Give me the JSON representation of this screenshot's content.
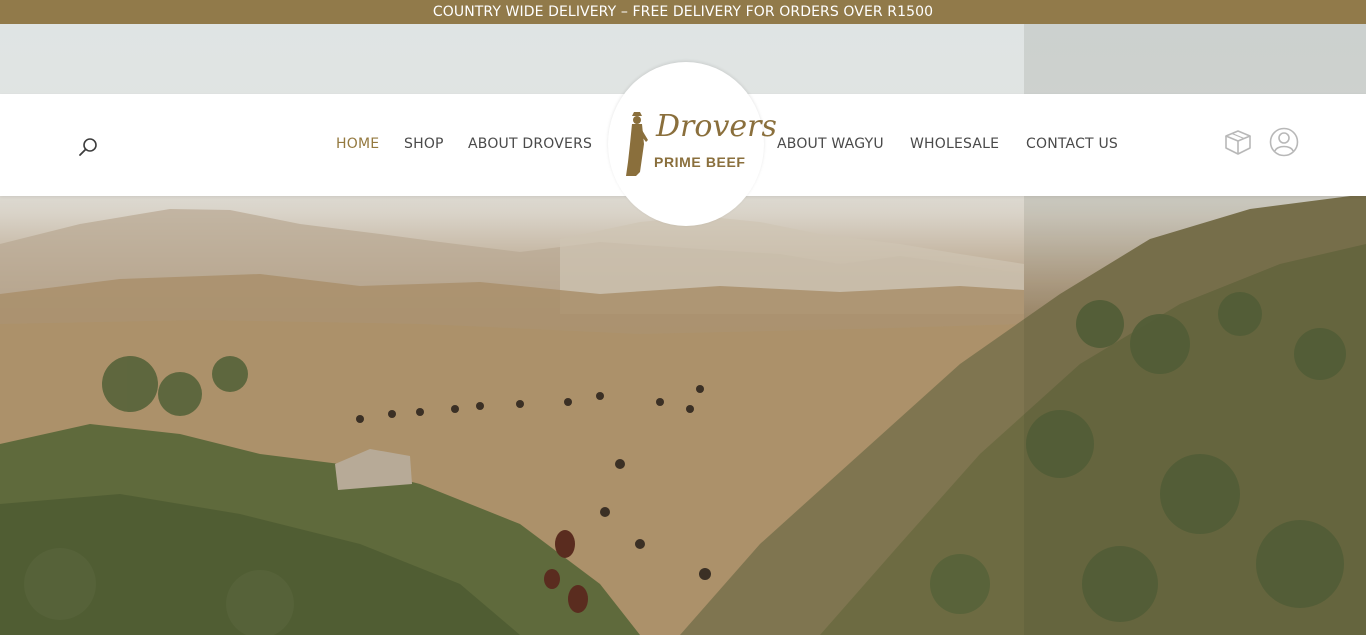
{
  "announcement": {
    "text": "COUNTRY WIDE DELIVERY – FREE DELIVERY FOR ORDERS OVER R1500"
  },
  "logo": {
    "name": "Drovers",
    "tagline": "PRIME BEEF"
  },
  "nav": {
    "left": [
      {
        "label": "HOME",
        "active": true
      },
      {
        "label": "SHOP",
        "active": false
      },
      {
        "label": "ABOUT DROVERS",
        "active": false
      }
    ],
    "right": [
      {
        "label": "ABOUT WAGYU",
        "active": false
      },
      {
        "label": "WHOLESALE",
        "active": false
      },
      {
        "label": "CONTACT US",
        "active": false
      }
    ]
  },
  "icons": {
    "search": "search-icon",
    "cart": "box-icon",
    "account": "user-icon"
  },
  "colors": {
    "brand": "#917a4a",
    "nav_text": "#4a4a4a",
    "nav_active": "#94793f"
  }
}
